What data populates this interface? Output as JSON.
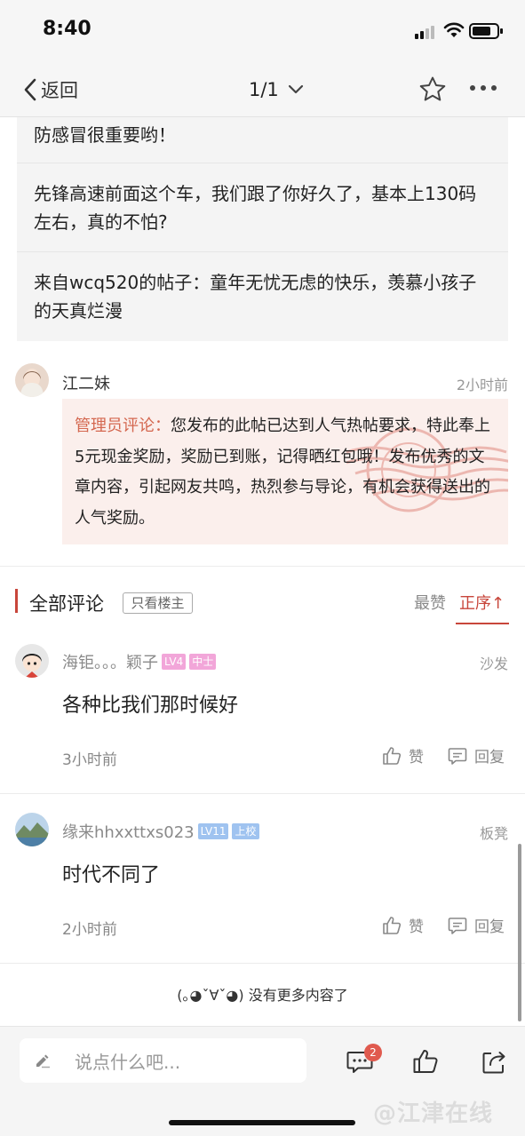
{
  "status_bar": {
    "time": "8:40"
  },
  "nav": {
    "back_label": "返回",
    "page_indicator": "1/1"
  },
  "quoted_posts": [
    {
      "text": "防感冒很重要哟！"
    },
    {
      "text": "先锋高速前面这个车，我们跟了你好久了，基本上130码左右，真的不怕?"
    },
    {
      "text": "来自wcq520的帖子：童年无忧无虑的快乐，羡慕小孩子的天真烂漫"
    }
  ],
  "admin_comment": {
    "author": "江二妹",
    "time": "2小时前",
    "label": "管理员评论：",
    "text": "您发布的此帖已达到人气热帖要求，特此奉上5元现金奖励，奖励已到账，记得晒红包哦！发布优秀的文章内容，引起网友共鸣，热烈参与导论，有机会获得送出的人气奖励。"
  },
  "comments_header": {
    "title": "全部评论",
    "author_only": "只看楼主",
    "sort_hot": "最赞",
    "sort_order": "正序↑"
  },
  "comments": [
    {
      "name": "海钜。。。颖子",
      "level": "LV4",
      "rank": "中士",
      "floor": "沙发",
      "text": "各种比我们那时候好",
      "time": "3小时前",
      "like_label": "赞",
      "reply_label": "回复"
    },
    {
      "name": "缘来hhxxttxs023",
      "level": "LV11",
      "rank": "上校",
      "floor": "板凳",
      "text": "时代不同了",
      "time": "2小时前",
      "like_label": "赞",
      "reply_label": "回复"
    }
  ],
  "footer_note": "(｡◕ˇ∀ˇ◕) 没有更多内容了",
  "bottom_bar": {
    "input_placeholder": "说点什么吧...",
    "comment_count": "2",
    "watermark": "@江津在线"
  },
  "colors": {
    "accent": "#c8463b",
    "admin_label": "#d4674f",
    "admin_bg": "#fbefec",
    "lv4_badge": "#f2a6d9",
    "lv11_badge": "#9fc3f0",
    "count_badge": "#e05a4e"
  }
}
